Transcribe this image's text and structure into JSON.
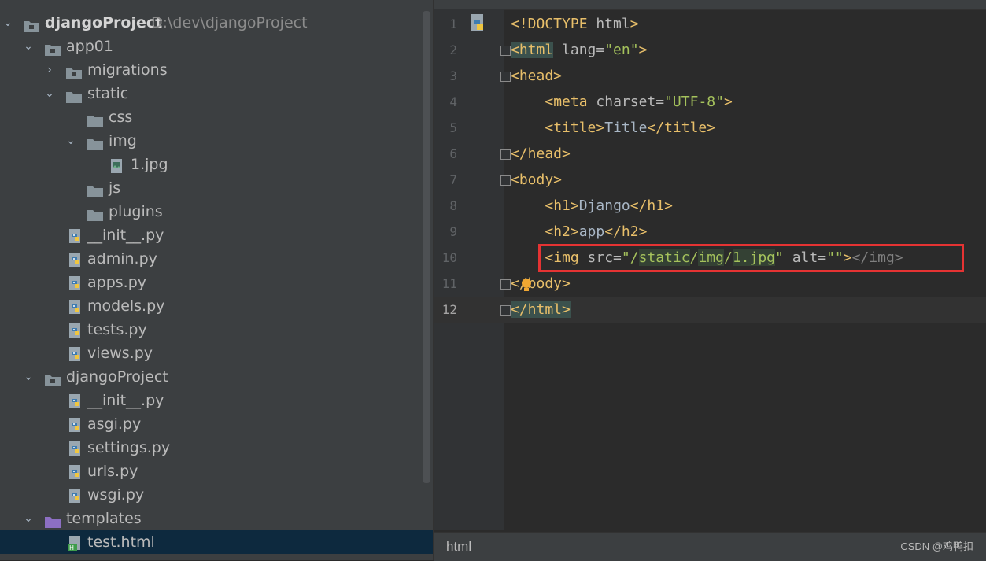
{
  "project_tree": {
    "items": [
      {
        "label": "djangoProject",
        "path": "D:\\dev\\djangoProject",
        "type": "module-folder",
        "expanded": true,
        "level": 0
      },
      {
        "label": "app01",
        "type": "module-folder",
        "expanded": true,
        "level": 1
      },
      {
        "label": "migrations",
        "type": "module-folder",
        "expanded": false,
        "level": 2
      },
      {
        "label": "static",
        "type": "folder",
        "expanded": true,
        "level": 2
      },
      {
        "label": "css",
        "type": "folder",
        "level": 3
      },
      {
        "label": "img",
        "type": "folder",
        "expanded": true,
        "level": 3
      },
      {
        "label": "1.jpg",
        "type": "image-file",
        "level": 4
      },
      {
        "label": "js",
        "type": "folder",
        "level": 3
      },
      {
        "label": "plugins",
        "type": "folder",
        "level": 3
      },
      {
        "label": "__init__.py",
        "type": "python-file",
        "level": 2
      },
      {
        "label": "admin.py",
        "type": "python-file",
        "level": 2
      },
      {
        "label": "apps.py",
        "type": "python-file",
        "level": 2
      },
      {
        "label": "models.py",
        "type": "python-file",
        "level": 2
      },
      {
        "label": "tests.py",
        "type": "python-file",
        "level": 2
      },
      {
        "label": "views.py",
        "type": "python-file",
        "level": 2
      },
      {
        "label": "djangoProject",
        "type": "module-folder",
        "expanded": true,
        "level": 1
      },
      {
        "label": "__init__.py",
        "type": "python-file",
        "level": 2
      },
      {
        "label": "asgi.py",
        "type": "python-file",
        "level": 2
      },
      {
        "label": "settings.py",
        "type": "python-file",
        "level": 2
      },
      {
        "label": "urls.py",
        "type": "python-file",
        "level": 2
      },
      {
        "label": "wsgi.py",
        "type": "python-file",
        "level": 2
      },
      {
        "label": "templates",
        "type": "template-folder",
        "expanded": true,
        "level": 1
      },
      {
        "label": "test.html",
        "type": "html-file",
        "level": 2,
        "selected": true
      }
    ]
  },
  "editor": {
    "lines": [
      {
        "n": "1",
        "text": "<!DOCTYPE html>"
      },
      {
        "n": "2",
        "text": "<html lang=\"en\">"
      },
      {
        "n": "3",
        "text": "<head>"
      },
      {
        "n": "4",
        "text": "    <meta charset=\"UTF-8\">"
      },
      {
        "n": "5",
        "text": "    <title>Title</title>"
      },
      {
        "n": "6",
        "text": "</head>"
      },
      {
        "n": "7",
        "text": "<body>"
      },
      {
        "n": "8",
        "text": "    <h1>Django</h1>"
      },
      {
        "n": "9",
        "text": "    <h2>app</h2>"
      },
      {
        "n": "10",
        "text": "    <img src=\"/static/img/1.jpg\" alt=\"\"></img>"
      },
      {
        "n": "11",
        "text": "</body>"
      },
      {
        "n": "12",
        "text": "</html>"
      }
    ],
    "current_line": "12",
    "highlighted_line": "10"
  },
  "statusbar": {
    "breadcrumb": "html",
    "watermark": "CSDN @鸡鸭扣"
  },
  "colors": {
    "tag": "#e8bf6a",
    "string": "#a5c25c",
    "attribute": "#bababa",
    "annotation_box": "#e53333"
  }
}
